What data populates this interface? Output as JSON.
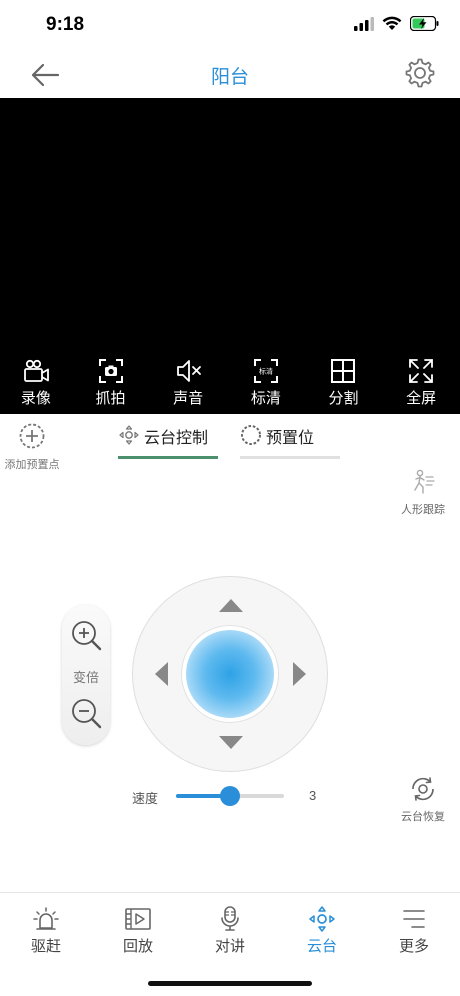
{
  "status_bar": {
    "time": "9:18"
  },
  "header": {
    "title": "阳台"
  },
  "video_toolbar": [
    {
      "label": "录像",
      "icon": "video-record-icon"
    },
    {
      "label": "抓拍",
      "icon": "camera-snapshot-icon"
    },
    {
      "label": "声音",
      "icon": "speaker-muted-icon"
    },
    {
      "label": "标清",
      "icon": "quality-sd-icon",
      "badge": "标清"
    },
    {
      "label": "分割",
      "icon": "split-grid-icon"
    },
    {
      "label": "全屏",
      "icon": "fullscreen-icon"
    }
  ],
  "preset": {
    "add_label": "添加预置点"
  },
  "tabs": [
    {
      "label": "云台控制",
      "active": true
    },
    {
      "label": "预置位",
      "active": false
    }
  ],
  "side_actions": {
    "human_tracking": "人形跟踪",
    "ptz_reset": "云台恢复"
  },
  "zoom": {
    "label": "变倍"
  },
  "speed": {
    "label": "速度",
    "value": "3",
    "fraction": 0.5
  },
  "bottom_nav": [
    {
      "label": "驱赶",
      "icon": "alarm-light-icon",
      "active": false
    },
    {
      "label": "回放",
      "icon": "playback-film-icon",
      "active": false
    },
    {
      "label": "对讲",
      "icon": "microphone-icon",
      "active": false
    },
    {
      "label": "云台",
      "icon": "ptz-icon",
      "active": true
    },
    {
      "label": "更多",
      "icon": "more-menu-icon",
      "active": false
    }
  ],
  "colors": {
    "accent": "#2a8fd8",
    "tab_active": "#4b8f6c",
    "video_bg": "#000000"
  }
}
